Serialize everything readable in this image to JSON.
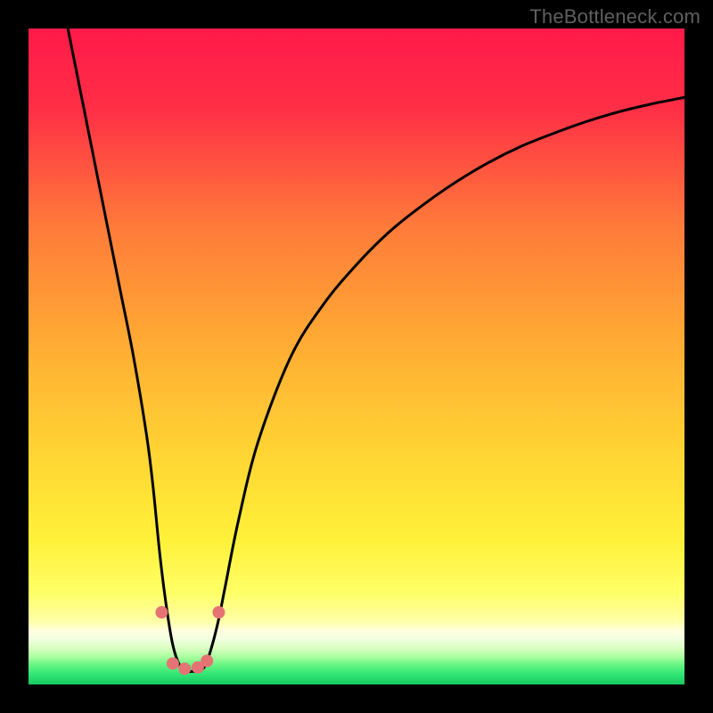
{
  "watermark": "TheBottleneck.com",
  "chart_data": {
    "type": "line",
    "title": "",
    "xlabel": "",
    "ylabel": "",
    "xlim": [
      0,
      100
    ],
    "ylim": [
      0,
      100
    ],
    "gradient_stops": [
      {
        "offset": 0.0,
        "color": "#ff1a49"
      },
      {
        "offset": 0.12,
        "color": "#ff2e46"
      },
      {
        "offset": 0.3,
        "color": "#ff7a3a"
      },
      {
        "offset": 0.5,
        "color": "#ffb133"
      },
      {
        "offset": 0.66,
        "color": "#ffd733"
      },
      {
        "offset": 0.78,
        "color": "#fff13a"
      },
      {
        "offset": 0.86,
        "color": "#ffff66"
      },
      {
        "offset": 0.905,
        "color": "#ffffaa"
      },
      {
        "offset": 0.918,
        "color": "#ffffe0"
      },
      {
        "offset": 0.93,
        "color": "#f2ffe0"
      },
      {
        "offset": 0.945,
        "color": "#d9ffc2"
      },
      {
        "offset": 0.958,
        "color": "#a9ff9e"
      },
      {
        "offset": 0.97,
        "color": "#66f582"
      },
      {
        "offset": 0.985,
        "color": "#2fe574"
      },
      {
        "offset": 1.0,
        "color": "#18c95e"
      }
    ],
    "series": [
      {
        "name": "bottleneck-curve",
        "x": [
          6,
          8,
          10,
          12,
          14,
          16,
          18,
          19,
          20,
          21,
          22,
          23,
          24,
          25,
          26,
          27,
          28,
          29,
          30,
          32,
          35,
          40,
          45,
          50,
          55,
          60,
          65,
          70,
          75,
          80,
          85,
          90,
          95,
          100
        ],
        "y": [
          100,
          90,
          80,
          70,
          60,
          50,
          38,
          30,
          20,
          12,
          6,
          3,
          2,
          2,
          2,
          3,
          6,
          10,
          15,
          25,
          37,
          50,
          58,
          64,
          69,
          73,
          76.5,
          79.5,
          82,
          84,
          85.8,
          87.3,
          88.5,
          89.5
        ]
      }
    ],
    "markers": {
      "name": "highlight-dots",
      "color": "#e57373",
      "radius": 7,
      "points": [
        {
          "x": 20.3,
          "y": 11
        },
        {
          "x": 22.0,
          "y": 3.2
        },
        {
          "x": 23.8,
          "y": 2.4
        },
        {
          "x": 25.8,
          "y": 2.6
        },
        {
          "x": 27.2,
          "y": 3.6
        },
        {
          "x": 29.0,
          "y": 11
        }
      ]
    }
  }
}
